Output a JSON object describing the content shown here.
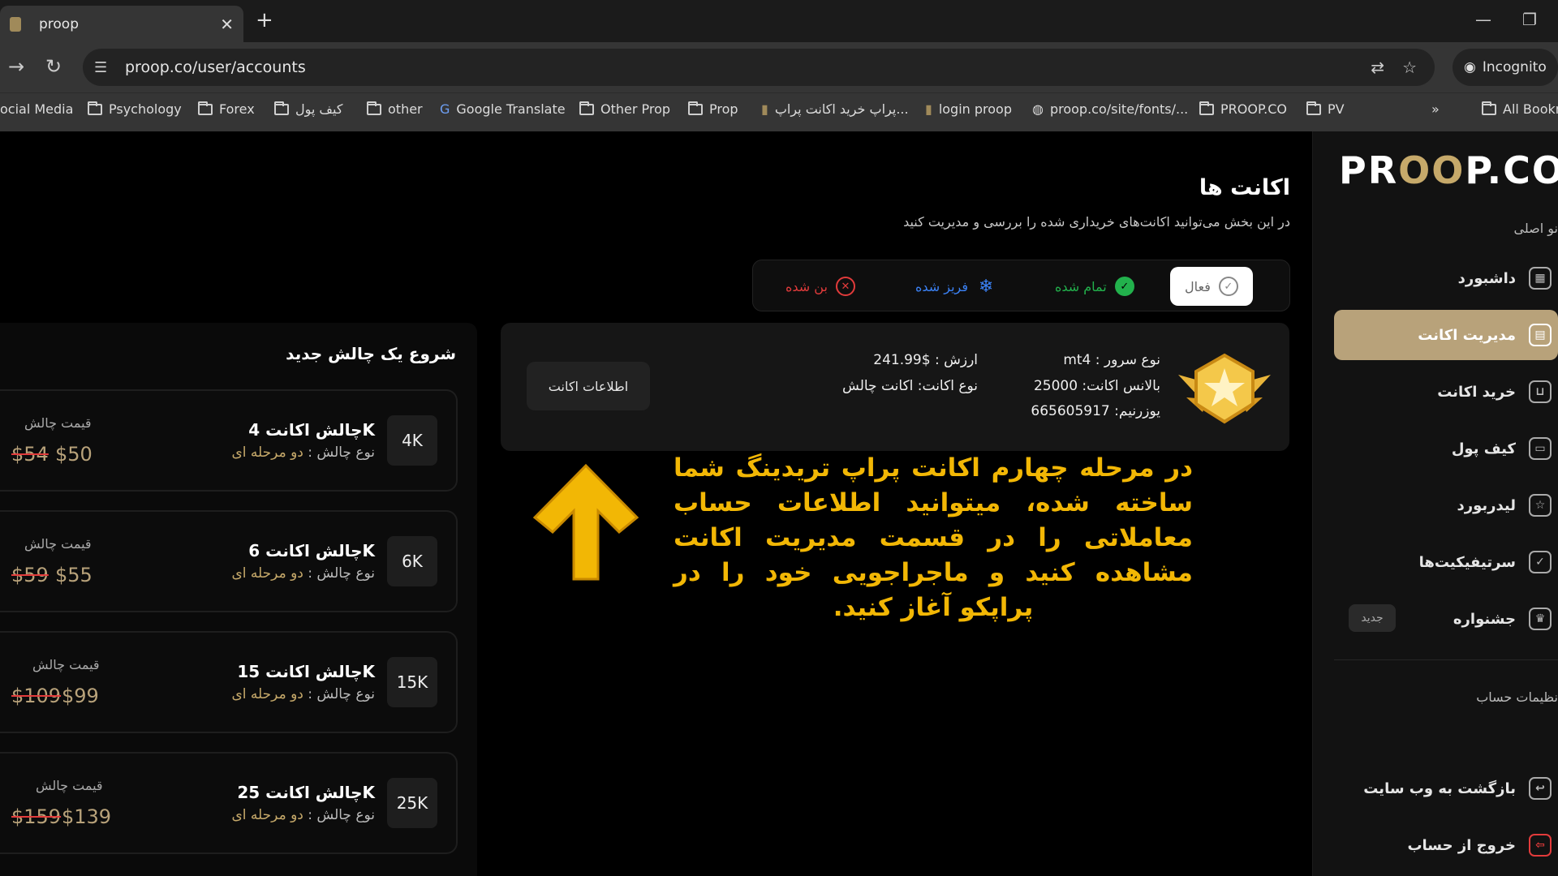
{
  "browser": {
    "tab_title": "proop",
    "url": "proop.co/user/accounts",
    "incognito_label": "Incognito",
    "bookmarks": [
      "ocial Media",
      "Psychology",
      "Forex",
      "کیف پول",
      "other",
      "Google Translate",
      "Other Prop",
      "Prop",
      "پراپ خرید اکانت پراپ...",
      "login proop",
      "proop.co/site/fonts/...",
      "PROOP.CO",
      "PV",
      "All Bookm"
    ]
  },
  "sidebar": {
    "logo_left": "PR",
    "logo_eyes": "OO",
    "logo_right": "P.CO",
    "main_menu_label": "نو اصلی",
    "items": [
      {
        "label": "داشبورد",
        "icon": "grid-icon"
      },
      {
        "label": "مدیریت اکانت",
        "icon": "account-icon"
      },
      {
        "label": "خرید اکانت",
        "icon": "cart-icon"
      },
      {
        "label": "کیف پول",
        "icon": "wallet-icon"
      },
      {
        "label": "لیدربورد",
        "icon": "star-icon"
      },
      {
        "label": "سرتیفیکیت‌ها",
        "icon": "certificate-icon"
      },
      {
        "label": "جشنواره",
        "icon": "trophy-icon"
      }
    ],
    "new_badge": "جدید",
    "settings_label": "نظیمات حساب",
    "bottom_items": [
      {
        "label": "بازگشت به وب سایت",
        "icon": "return-icon"
      },
      {
        "label": "خروج از حساب",
        "icon": "logout-icon"
      }
    ]
  },
  "main": {
    "title": "اکانت ها",
    "subtitle": "در این بخش می‌توانید اکانت‌های خریداری شده را بررسی و مدیریت کنید",
    "filters": [
      {
        "label": "فعال",
        "color": "#666666"
      },
      {
        "label": "تمام شده",
        "color": "#22b14c"
      },
      {
        "label": "فریز شده",
        "color": "#3b82f6"
      },
      {
        "label": "بن شده",
        "color": "#e23b3b"
      }
    ],
    "account": {
      "server_type": "نوع سرور : mt4",
      "balance": "بالانس اکانت: 25000",
      "username": "یوزرنیم: 665605917",
      "value": "ارزش : $241.99",
      "account_type": "نوع اکانت: اکانت چالش",
      "info_button": "اطلاعات اکانت"
    },
    "overlay": "در مرحله چهارم اکانت پراپ تریدینگ شما ساخته شده، میتوانید اطلاعات حساب معاملاتی را در قسمت مدیریت اکانت مشاهده کنید و ماجراجویی خود را در پراپکو آغاز کنید."
  },
  "challenges": {
    "title": "شروع یک چالش جدید",
    "price_label": "قیمت چالش",
    "type_prefix": "نوع چالش :",
    "type_value": "دو مرحله ای",
    "items": [
      {
        "size": "4K",
        "name": "چالش اکانت 4K",
        "old": "$54",
        "price": "$50"
      },
      {
        "size": "6K",
        "name": "چالش اکانت 6K",
        "old": "$59",
        "price": "$55"
      },
      {
        "size": "15K",
        "name": "چالش اکانت 15K",
        "old": "$109",
        "price": "$99"
      },
      {
        "size": "25K",
        "name": "چالش اکانت 25K",
        "old": "$159",
        "price": "$139"
      }
    ]
  }
}
